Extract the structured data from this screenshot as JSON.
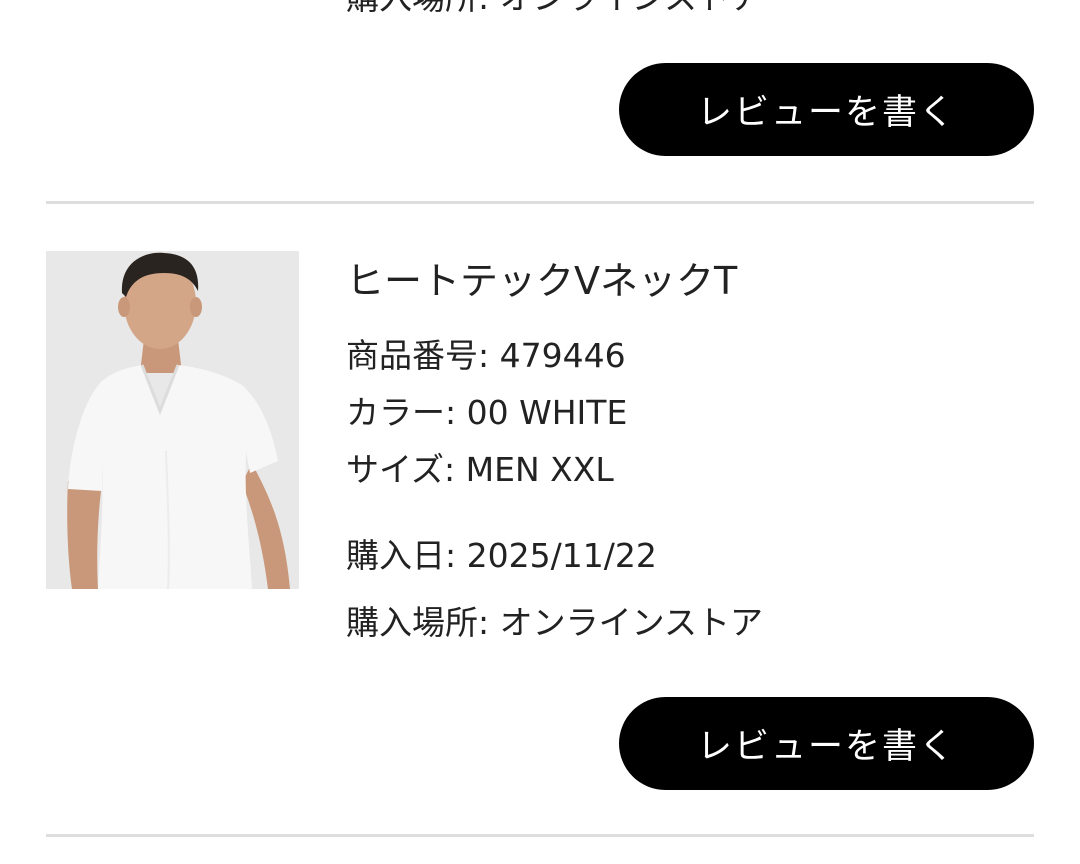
{
  "previous_item": {
    "purchase_place_line": "購入場所: オンラインストア",
    "review_button": "レビューを書く"
  },
  "item": {
    "name": "ヒートテックVネックT",
    "product_number_label": "商品番号:",
    "product_number": "479446",
    "color_label": "カラー:",
    "color": "00 WHITE",
    "size_label": "サイズ:",
    "size": "MEN XXL",
    "purchase_date_label": "購入日:",
    "purchase_date": "2025/11/22",
    "purchase_place_label": "購入場所:",
    "purchase_place": "オンラインストア",
    "review_button": "レビューを書く"
  }
}
